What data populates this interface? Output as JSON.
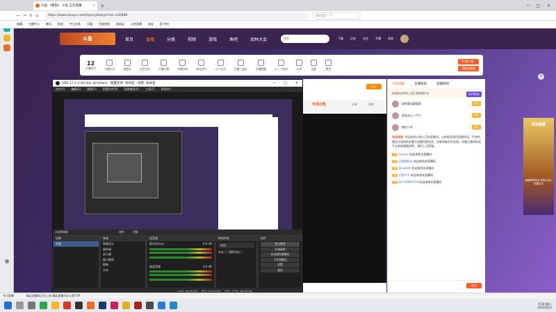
{
  "browser": {
    "tab_title": "斗鱼-《教程》 斗鱼 正在直播",
    "url": "https://www.douyu.com/topic/ybtokyo?rid=230680",
    "search_placeholder": "搜狗搜索一下",
    "bookmarks": [
      "收藏",
      "主播中心",
      "腾讯",
      "新浪",
      "今日头条",
      "天猫",
      "百度地图",
      "网易云",
      "斗鱼直播",
      "淘宝",
      "JD 京东"
    ]
  },
  "douyu": {
    "logo": "斗鱼",
    "menu": [
      "首页",
      "直播",
      "分类",
      "视频",
      "游戏",
      "鱼吧",
      "武林大会"
    ],
    "search_placeholder": "搜索",
    "top_icons": [
      "下载",
      "历史",
      "关注",
      "开播",
      "消息"
    ],
    "level": "12",
    "level_label": "主播积分",
    "categories": [
      "主播开关",
      "推荐区",
      "全民学车",
      "主播日报",
      "专属特权",
      "粉丝排行",
      "火力全开",
      "主播一起玩",
      "开播提醒",
      "上一个房间",
      "分享",
      "连麦",
      "更多"
    ],
    "pc_btn": "PC客户端",
    "pc_btn2": "直播间管理",
    "stream_header": {
      "follow": "关注",
      "leaderboard": "可领次数",
      "share": "分享",
      "report": "举报"
    }
  },
  "obs": {
    "title": "OBS 27.1.3 (64-bit, windows) - 配置文件: 未命名 - 场景: 未命名",
    "menu": [
      "文件(F)",
      "编辑(E)",
      "视图(V)",
      "配置文件(P)",
      "场景集合(S)",
      "工具(T)",
      "帮助(H)"
    ],
    "scenes_header": "场景",
    "scenes": [
      "场景"
    ],
    "sources_header": "来源",
    "sources": [
      "图像显示",
      "媒体源",
      "显示器",
      "窗口捕获",
      "图像",
      "文本"
    ],
    "mixer_header": "混音器",
    "mixer": [
      {
        "name": "麦克风/Aux",
        "db": "-0.0 dB"
      },
      {
        "name": "桌面音频",
        "db": "0.0 dB"
      }
    ],
    "transitions_header": "转场特效",
    "transition_type": "淡出",
    "duration_label": "时长",
    "duration": "300 ms",
    "controls_header": "控件",
    "controls": [
      "停止推流",
      "开始录制",
      "启动虚拟摄像机",
      "工作室模式",
      "设置",
      "退出"
    ],
    "no_source": "未选择来源",
    "props_btn": "属性",
    "filters_btn": "滤镜",
    "status": [
      "LIVE: 00:00:00",
      "REC: 00:00:00",
      "CPU: 3.3%, 60.00 fps"
    ]
  },
  "chat": {
    "tabs": [
      "今日贡献",
      "主播排名",
      "直播周榜"
    ],
    "notice": "本周粉丝榜单上周已解锁第1名",
    "notice_btn": "成为粉丝",
    "rankings": [
      {
        "name": "迷你窝机器管家",
        "tag": "排名"
      },
      {
        "name": "蓝海北山一片片",
        "tag": "排名"
      },
      {
        "name": "兽世少爷",
        "tag": "排名"
      }
    ],
    "system_label": "系统消息:",
    "system_text": "欢迎来到斗鱼小卫的直播间，斗鱼倡导绿色直播内容，严禁传播违法违规低俗暴力血腥色情信息，违者将被封号处理。如遇主播诱导私下交易请谨慎判断，谨防上当受骗。",
    "messages": [
      {
        "level": "15",
        "name": "liukivei",
        "text": "欢迎来到本直播间"
      },
      {
        "level": "14",
        "name": "佳德娜粉丝",
        "text": "欢迎来到本直播间"
      },
      {
        "level": "13",
        "name": "hkudd16",
        "text": "欢迎来到本直播间"
      },
      {
        "level": "15",
        "name": "打哦今天",
        "text": "欢迎来到本直播间"
      },
      {
        "level": "15",
        "name": "用户58629316",
        "text": "欢迎来到本直播间"
      }
    ],
    "send": "发送"
  },
  "ad": {
    "title": "武林群雄",
    "subtitle": "赢取精美周边 武林大会火热报名中"
  },
  "notifybar": [
    "今日直播",
    "精品直播间正式上线 精彩直播尽在斗鱼TOP"
  ],
  "taskbar": {
    "time": "9:20 周二",
    "date": "2022/3/22",
    "icons": [
      "start",
      "search",
      "task",
      "edge",
      "folder",
      "chrome",
      "obs",
      "douyu",
      "steam",
      "media",
      "music",
      "game",
      "mail",
      "net",
      "app"
    ]
  },
  "colors": {
    "accent": "#ff5d23",
    "douyu_purple": "#3a2450",
    "obs_dark": "#2b2b2b"
  }
}
